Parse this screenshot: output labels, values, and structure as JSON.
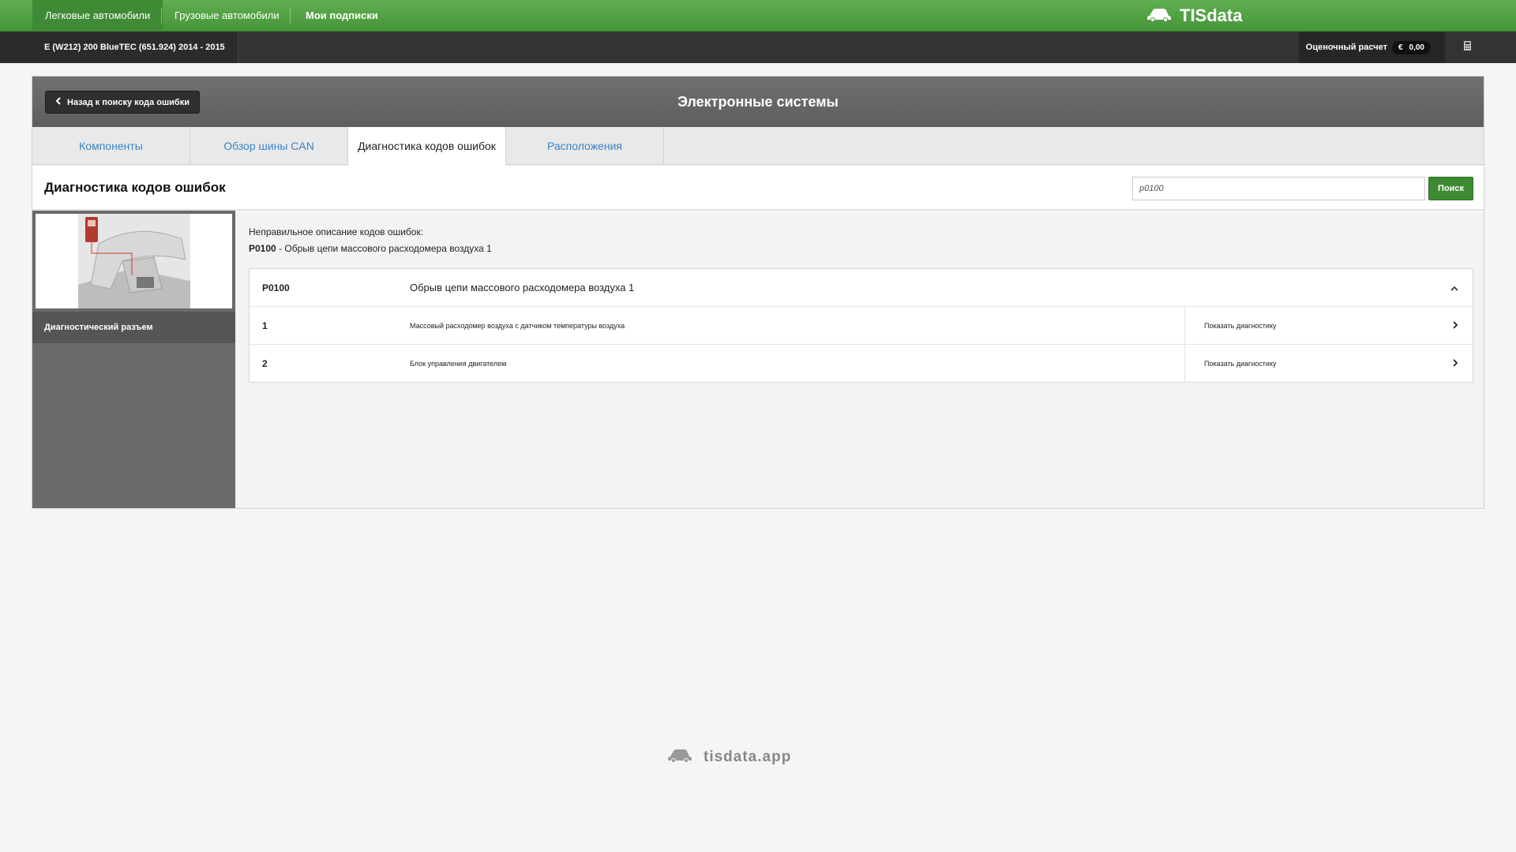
{
  "topnav": {
    "items": [
      "Легковые автомобили",
      "Грузовые автомобили",
      "Мои подписки"
    ],
    "brand": "TISdata"
  },
  "subbar": {
    "vehicle": "E (W212) 200 BlueTEC (651.924) 2014 - 2015",
    "estimate_label": "Оценочный расчет",
    "currency": "€",
    "amount": "0,00"
  },
  "panel": {
    "back_label": "Назад к поиску кода ошибки",
    "title": "Электронные системы",
    "tabs": [
      "Компоненты",
      "Обзор шины CAN",
      "Диагностика кодов ошибок",
      "Расположения"
    ],
    "active_tab": 2
  },
  "section": {
    "title": "Диагностика кодов ошибок",
    "search_value": "p0100",
    "search_button": "Поиск"
  },
  "sidebar": {
    "label": "Диагностический разъем"
  },
  "content": {
    "note": "Неправильное описание кодов ошибок:",
    "note_code": "P0100",
    "note_desc": " - Обрыв цепи массового расходомера воздуха 1",
    "table": {
      "head": {
        "code": "P0100",
        "desc": "Обрыв цепи массового расходомера воздуха 1"
      },
      "rows": [
        {
          "num": "1",
          "desc": "Массовый расходомер воздуха с датчиком температуры воздуха",
          "action": "Показать диагностику"
        },
        {
          "num": "2",
          "desc": "Блок управления двигателем",
          "action": "Показать диагностику"
        }
      ]
    }
  },
  "footer": {
    "text": "tisdata.app"
  },
  "colors": {
    "green": "#4fa043",
    "dark_bar": "#333333",
    "link_blue": "#3a84c4"
  }
}
